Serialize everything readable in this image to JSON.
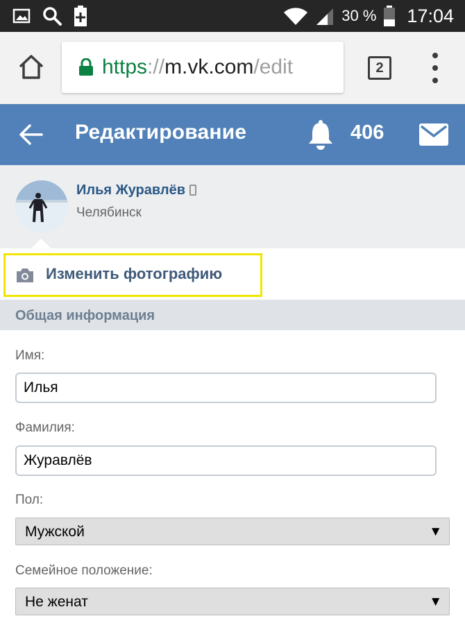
{
  "status_bar": {
    "battery_percent": "30 %",
    "time": "17:04",
    "icons": [
      "image-icon",
      "search-icon",
      "battery-saver-icon",
      "wifi-icon",
      "signal-icon",
      "battery-icon"
    ]
  },
  "browser": {
    "url_scheme": "https",
    "url_sep": "://",
    "url_host": "m.vk.com",
    "url_path": "/edit",
    "tab_count": "2"
  },
  "header": {
    "title": "Редактирование",
    "notification_count": "406",
    "background": "#5181b8"
  },
  "profile": {
    "name": "Илья Журавлёв",
    "city": "Челябинск"
  },
  "change_photo": {
    "label": "Изменить фотографию",
    "highlight_color": "#f2e500"
  },
  "section": {
    "title": "Общая информация"
  },
  "form": {
    "first_name": {
      "label": "Имя:",
      "value": "Илья"
    },
    "last_name": {
      "label": "Фамилия:",
      "value": "Журавлёв"
    },
    "gender": {
      "label": "Пол:",
      "value": "Мужской"
    },
    "relationship": {
      "label": "Семейное положение:",
      "value": "Не женат"
    }
  }
}
